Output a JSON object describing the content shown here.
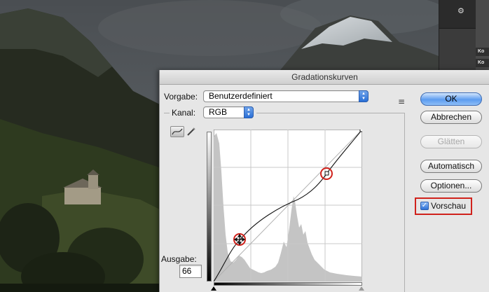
{
  "app_panel": {
    "icon": "panel-layers-icon",
    "labels": [
      "Ko",
      "Ko"
    ]
  },
  "dialog": {
    "title": "Gradationskurven",
    "preset_label": "Vorgabe:",
    "preset_value": "Benutzerdefiniert",
    "preset_menu_icon": "preset-options-icon",
    "channel_label": "Kanal:",
    "channel_value": "RGB",
    "output_label": "Ausgabe:",
    "output_value": "66",
    "tools": [
      "curve-points-icon",
      "pencil-icon"
    ]
  },
  "buttons": {
    "ok": "OK",
    "cancel": "Abbrechen",
    "smooth": "Glätten",
    "auto": "Automatisch",
    "options": "Optionen..."
  },
  "preview": {
    "label": "Vorschau",
    "checked": true
  },
  "colors": {
    "highlight_red": "#d0221c",
    "accent_blue": "#2a6fd6"
  }
}
